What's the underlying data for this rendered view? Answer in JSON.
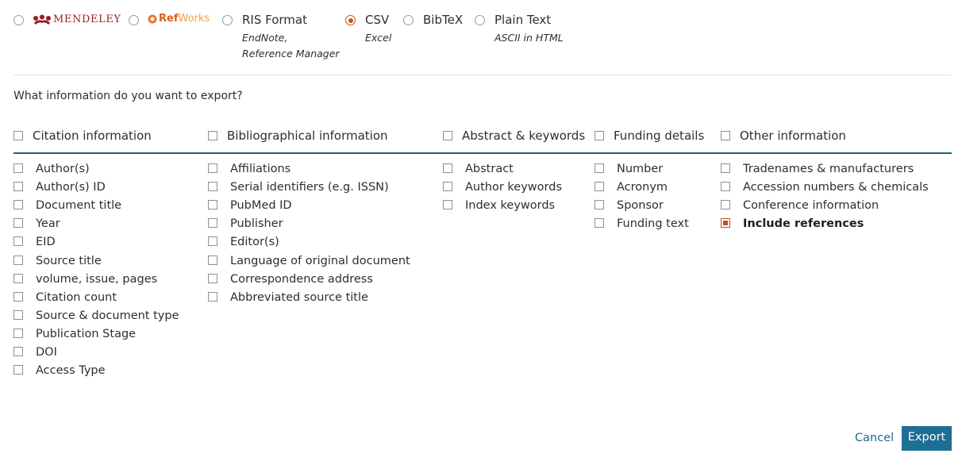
{
  "formats": {
    "mendeley": {
      "logo_text": "MENDELEY",
      "selected": false
    },
    "refworks": {
      "logo_ref": "Ref",
      "logo_works": "Works",
      "selected": false
    },
    "ris": {
      "label": "RIS Format",
      "sub1": "EndNote,",
      "sub2": "Reference Manager",
      "selected": false
    },
    "csv": {
      "label": "CSV",
      "sub1": "Excel",
      "selected": true
    },
    "bibtex": {
      "label": "BibTeX",
      "selected": false
    },
    "plaintext": {
      "label": "Plain Text",
      "sub1": "ASCII in HTML",
      "selected": false
    }
  },
  "question": "What information do you want to export?",
  "groups": [
    {
      "heading": "Citation information",
      "checked": false,
      "items": [
        {
          "label": "Author(s)",
          "checked": false
        },
        {
          "label": "Author(s) ID",
          "checked": false
        },
        {
          "label": "Document title",
          "checked": false
        },
        {
          "label": "Year",
          "checked": false
        },
        {
          "label": "EID",
          "checked": false
        },
        {
          "label": "Source title",
          "checked": false
        },
        {
          "label": "volume, issue, pages",
          "checked": false
        },
        {
          "label": "Citation count",
          "checked": false
        },
        {
          "label": "Source & document type",
          "checked": false
        },
        {
          "label": "Publication Stage",
          "checked": false
        },
        {
          "label": "DOI",
          "checked": false
        },
        {
          "label": "Access Type",
          "checked": false
        }
      ]
    },
    {
      "heading": "Bibliographical information",
      "checked": false,
      "items": [
        {
          "label": "Affiliations",
          "checked": false
        },
        {
          "label": "Serial identifiers (e.g. ISSN)",
          "checked": false
        },
        {
          "label": "PubMed ID",
          "checked": false
        },
        {
          "label": "Publisher",
          "checked": false
        },
        {
          "label": "Editor(s)",
          "checked": false
        },
        {
          "label": "Language of original document",
          "checked": false
        },
        {
          "label": "Correspondence address",
          "checked": false
        },
        {
          "label": "Abbreviated source title",
          "checked": false
        }
      ]
    },
    {
      "heading": "Abstract & keywords",
      "checked": false,
      "items": [
        {
          "label": "Abstract",
          "checked": false
        },
        {
          "label": "Author keywords",
          "checked": false
        },
        {
          "label": "Index keywords",
          "checked": false
        }
      ]
    },
    {
      "heading": "Funding details",
      "checked": false,
      "items": [
        {
          "label": "Number",
          "checked": false
        },
        {
          "label": "Acronym",
          "checked": false
        },
        {
          "label": "Sponsor",
          "checked": false
        },
        {
          "label": "Funding text",
          "checked": false
        }
      ]
    },
    {
      "heading": "Other information",
      "checked": false,
      "items": [
        {
          "label": "Tradenames & manufacturers",
          "checked": false
        },
        {
          "label": "Accession numbers & chemicals",
          "checked": false
        },
        {
          "label": "Conference information",
          "checked": false
        },
        {
          "label": "Include references",
          "checked": true
        }
      ]
    }
  ],
  "actions": {
    "cancel_label": "Cancel",
    "export_label": "Export"
  },
  "colors": {
    "accent": "#c4541e",
    "primary": "#1f6e94",
    "link": "#1a6a96",
    "rule": "#1f5e7c"
  }
}
